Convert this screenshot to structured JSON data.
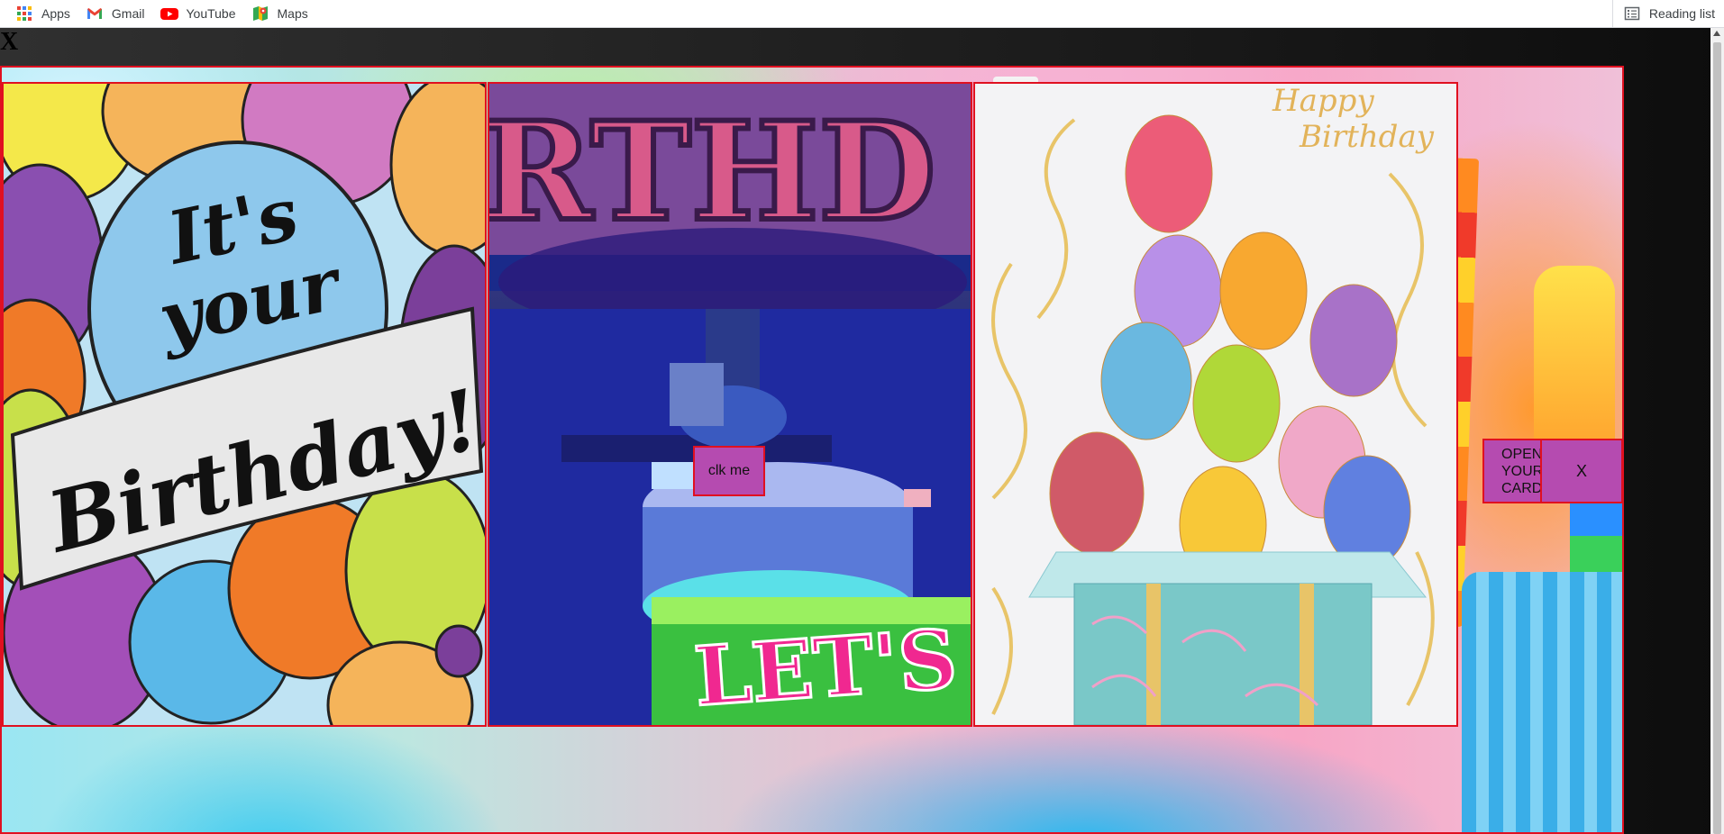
{
  "bookmarks": {
    "items": [
      {
        "label": "Apps",
        "icon": "apps-grid-icon"
      },
      {
        "label": "Gmail",
        "icon": "gmail-icon"
      },
      {
        "label": "YouTube",
        "icon": "youtube-icon"
      },
      {
        "label": "Maps",
        "icon": "maps-icon"
      }
    ],
    "reading_list": "Reading list"
  },
  "page": {
    "close_top": "X",
    "cards": [
      {
        "image": "its-your-birthday-balloons",
        "text_line1": "It's",
        "text_line2": "your",
        "text_line3": "Birthday!"
      },
      {
        "image": "graffiti-birthday-cake",
        "banner_text": "RTHD",
        "box_text": "LET'S"
      },
      {
        "image": "balloons-gift-box",
        "text_line1": "Happy",
        "text_line2": "Birthday"
      }
    ],
    "click_button": "clk me",
    "open_card_button": "OPEN YOUR CARD",
    "close_button": "X"
  },
  "colors": {
    "border": "#e01020",
    "button": "#b54bb0"
  }
}
